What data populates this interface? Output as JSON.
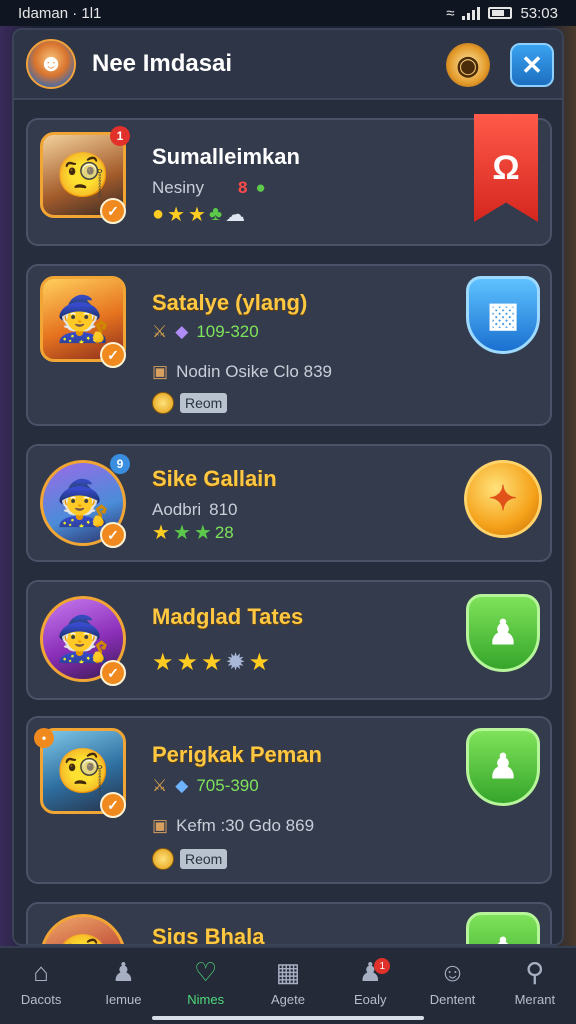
{
  "status_bar": {
    "left_text": "Idaman · 1l1",
    "time": "53:03"
  },
  "header": {
    "title": "Nee Imdasai",
    "avatar_icon": "avatar-icon",
    "settings_icon": "settings-icon",
    "close_icon": "close-icon"
  },
  "cards": [
    {
      "name": "Sumalleimkan",
      "subtitle": "Nesiny",
      "value_red": "8",
      "corner_badge": "1",
      "action_icon": "ribbon-icon"
    },
    {
      "name": "Satalye (ylang)",
      "range": "109-320",
      "detail": "Nodin Osike Clo  839",
      "room": "Reom",
      "action_icon": "chart-shield-icon"
    },
    {
      "name": "Sike Gallain",
      "subtitle": "Aodbri",
      "value": "810",
      "stars_value": "28",
      "corner_badge": "9",
      "action_icon": "orb-icon"
    },
    {
      "name": "Madglad Tates",
      "action_icon": "user-shield-icon"
    },
    {
      "name": "Perigkak Peman",
      "range": "705-390",
      "detail": "Kefm  :30  Gdo  869",
      "room": "Reom",
      "action_icon": "user-shield-icon"
    },
    {
      "name": "Sigs Bhala",
      "action_icon": "user-shield-icon"
    }
  ],
  "bottom_nav": [
    {
      "label": "Dacots",
      "icon": "home-icon"
    },
    {
      "label": "Iemue",
      "icon": "profile-icon"
    },
    {
      "label": "Nimes",
      "icon": "heart-icon",
      "active": true
    },
    {
      "label": "Agete",
      "icon": "calendar-icon"
    },
    {
      "label": "Eoaly",
      "icon": "friends-icon",
      "badge": "1"
    },
    {
      "label": "Dentent",
      "icon": "mask-icon"
    },
    {
      "label": "Merant",
      "icon": "search-icon"
    }
  ],
  "colors": {
    "accent_green": "#4fd97a",
    "gold_text": "#ffc842",
    "panel": "#262d3d"
  }
}
